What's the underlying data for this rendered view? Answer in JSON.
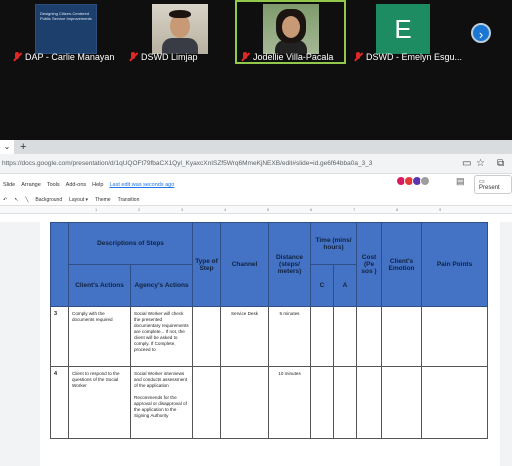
{
  "participants": [
    {
      "name": "DAP - Carlie Manayan",
      "thumb_text": "Designing Citizen-Centered Public Service Improvements",
      "muted": true
    },
    {
      "name": "DSWD Limjap",
      "muted": true
    },
    {
      "name": "Jodellie Villa-Pacala",
      "muted": true
    },
    {
      "name": "DSWD - Emelyn Esgu...",
      "initial": "E",
      "muted": true
    }
  ],
  "browser": {
    "new_tab": "+",
    "url": "https://docs.google.com/presentation/d/1qUQOFt79fbaCX1Qyl_KyaxcXnISZf5Wrq6MmeKjNEXB/edit#slide=id.ge6f64bba0a_3_3",
    "menu": [
      "Slide",
      "Arrange",
      "Tools",
      "Add-ons",
      "Help"
    ],
    "last_edit": "Last edit was seconds ago",
    "present_label": "Present",
    "toolbar": [
      "Background",
      "Layout ▾",
      "Theme",
      "Transition"
    ],
    "ruler": [
      "1",
      "2",
      "3",
      "4",
      "5",
      "6",
      "7",
      "8",
      "9"
    ]
  },
  "table": {
    "headers": {
      "descriptions": "Descriptions of Steps",
      "client_actions": "Client's Actions",
      "agency_actions": "Agency's Actions",
      "type": "Type of Step",
      "channel": "Channel",
      "distance": "Distance (steps/ meters)",
      "time": "Time (mins/ hours)",
      "c": "C",
      "a": "A",
      "cost": "Cost (Pe sos )",
      "emotion": "Client's Emotion",
      "pain": "Pain Points"
    },
    "rows": [
      {
        "num": "3",
        "client": "Comply with the documents required",
        "agency": "Social Worker will check the presented documentary requirements are complete... If not, the client will be asked to comply. If Complete, proceed to",
        "type": "",
        "channel": "Service Desk",
        "distance": "5 minutes"
      },
      {
        "num": "4",
        "client": "Client to respond to the questions of the Social Worker",
        "agency": "Social Worker interviews and conducts assessment of the application\n\nRecommends for the approval or disapproval of the application to the Signing Authority",
        "type": "",
        "channel": "",
        "distance": "10 minutes"
      }
    ]
  }
}
